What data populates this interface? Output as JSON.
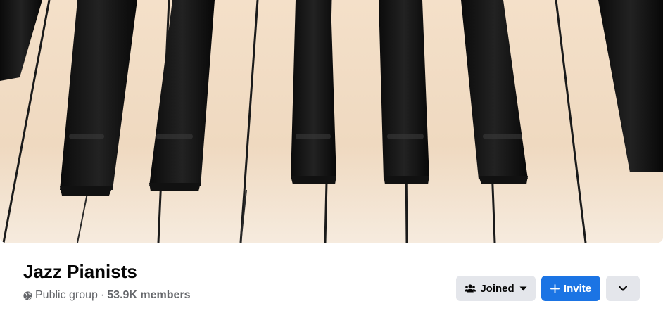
{
  "group": {
    "name": "Jazz Pianists",
    "privacy": "Public group",
    "separator": "·",
    "members": "53.9K members"
  },
  "actions": {
    "joined_label": "Joined",
    "invite_label": "Invite"
  },
  "cover": {
    "description_icon": "piano-keys-photo"
  },
  "colors": {
    "primary": "#1b74e4",
    "secondary_button": "#e4e6eb",
    "text_primary": "#050505",
    "text_secondary": "#65676b"
  },
  "icons": {
    "privacy": "globe-icon",
    "joined": "group-members-icon",
    "joined_caret": "caret-down-icon",
    "invite": "plus-icon",
    "more": "chevron-down-icon"
  }
}
